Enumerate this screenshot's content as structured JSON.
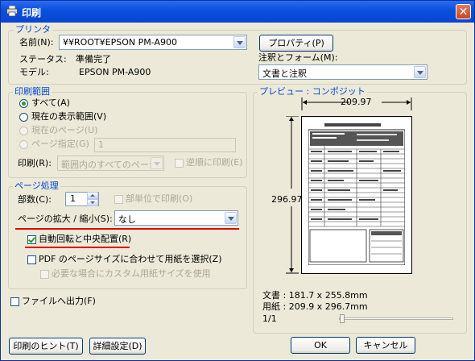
{
  "window": {
    "title": "印刷",
    "close_label": "✕"
  },
  "printer": {
    "group_label": "プリンタ",
    "name_label": "名前(N):",
    "name_value": "¥¥ROOT¥EPSON PM-A900",
    "properties_label": "プロパティ(P)",
    "status_label": "ステータス:",
    "status_value": "準備完了",
    "model_label": "モデル:",
    "model_value": "EPSON PM-A900",
    "comments_label": "注釈とフォーム(M):",
    "comments_value": "文書と注釈"
  },
  "range": {
    "group_label": "印刷範囲",
    "all_label": "すべて(A)",
    "view_label": "現在の表示範囲(V)",
    "page_label": "現在のページ(U)",
    "pages_label": "ページ指定(G)",
    "pages_value": "1",
    "subset_label": "印刷(R):",
    "subset_value": "範囲内のすべてのページ",
    "reverse_label": "逆順に印刷(E)"
  },
  "handling": {
    "group_label": "ページ処理",
    "copies_label": "部数(C):",
    "copies_value": "1",
    "collate_label": "部単位で印刷(O)",
    "scaling_label": "ページの拡大 / 縮小(S):",
    "scaling_value": "なし",
    "autorotate_label": "自動回転と中央配置(R)",
    "choose_source_label": "PDF のページサイズに合わせて用紙を選択(Z)",
    "custom_paper_label": "必要な場合にカスタム用紙サイズを使用"
  },
  "print_to_file_label": "ファイルへ出力(F)",
  "preview": {
    "group_label": "プレビュー : コンポジット",
    "width_value": "209.97",
    "height_value": "296.97",
    "document_line": "文書 : 181.7 x 255.8mm",
    "paper_line": "用紙 : 209.9 x 296.7mm",
    "page_counter": "1/1",
    "slider_position": 0.01
  },
  "footer": {
    "hint_label": "印刷のヒント(T)",
    "advanced_label": "詳細設定(D)",
    "ok_label": "OK",
    "cancel_label": "キャンセル"
  },
  "colors": {
    "title_bar": "#0a4fdc",
    "group_label": "#0046d5",
    "highlight": "#e00000",
    "check": "#21a121"
  }
}
